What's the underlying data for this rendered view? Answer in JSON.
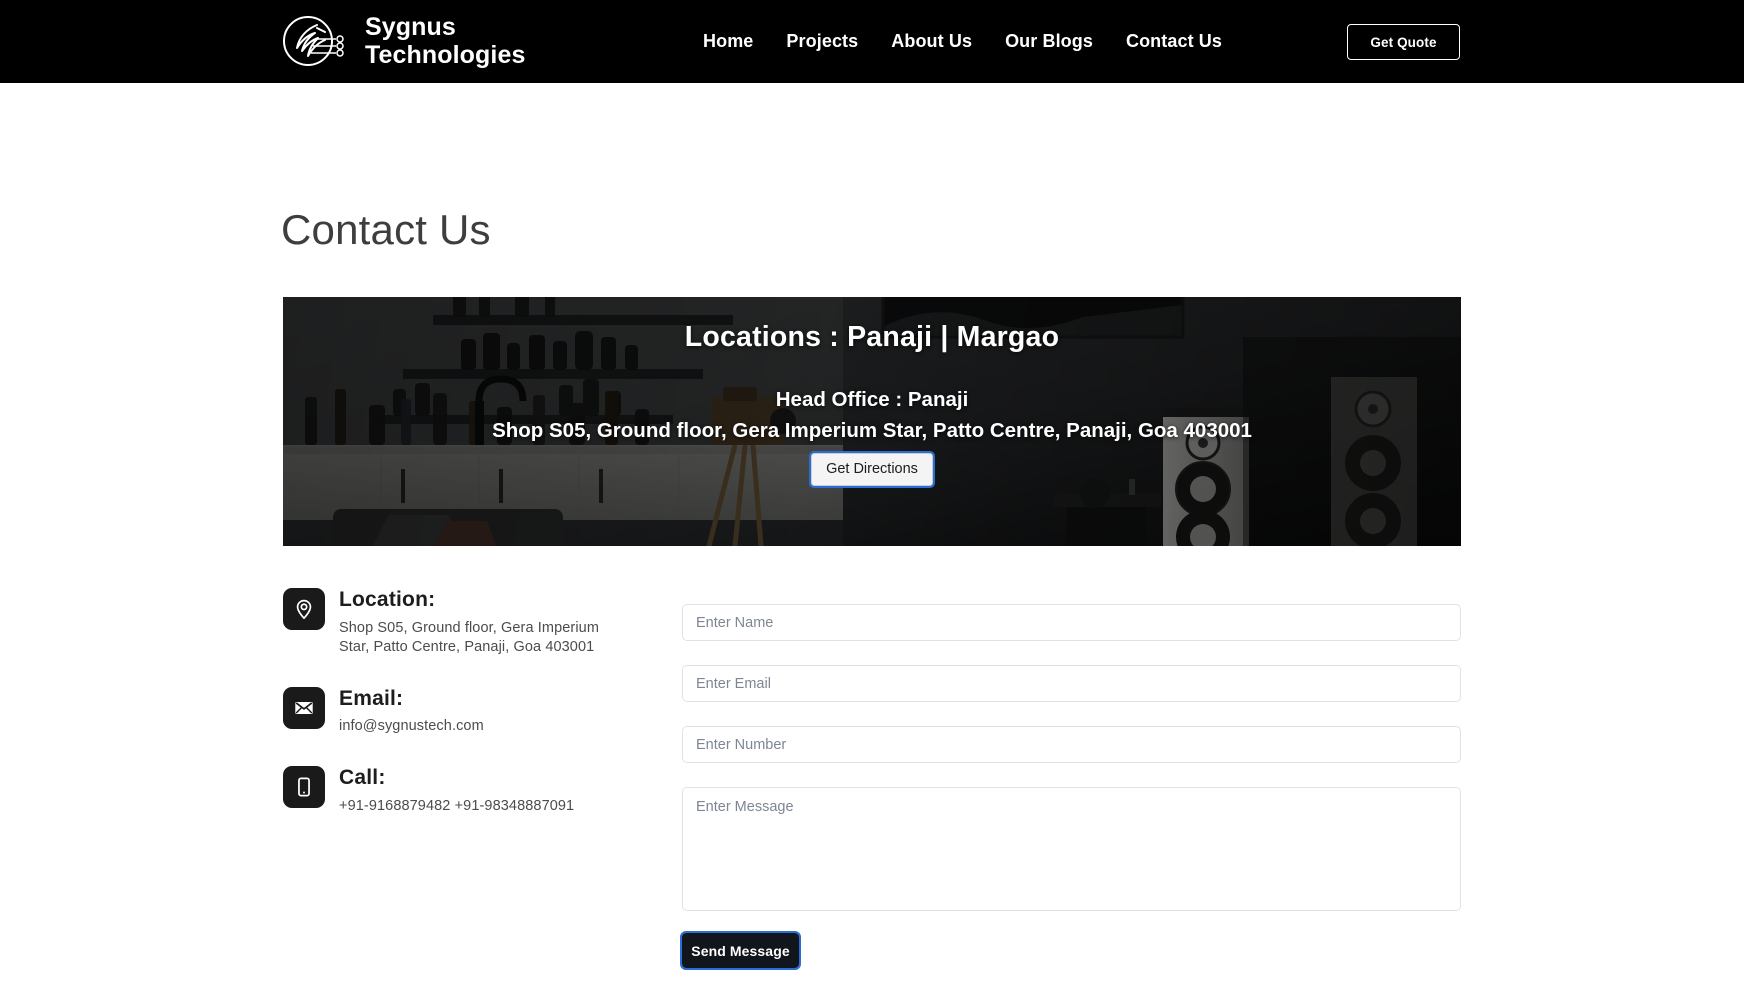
{
  "header": {
    "brand": {
      "name": "Sygnus\nTechnologies",
      "logo_icon": "sygnus-bird-circuit-logo"
    },
    "nav": [
      {
        "label": "Home"
      },
      {
        "label": "Projects"
      },
      {
        "label": "About Us"
      },
      {
        "label": "Our Blogs"
      },
      {
        "label": "Contact Us"
      }
    ],
    "quote_button": "Get Quote"
  },
  "page": {
    "title": "Contact Us"
  },
  "hero": {
    "locations": "Locations : Panaji | Margao",
    "head_office": "Head Office : Panaji",
    "address": "Shop S05, Ground floor, Gera Imperium Star, Patto Centre, Panaji, Goa 403001",
    "directions_button": "Get Directions"
  },
  "contact_info": [
    {
      "icon": "map-pin-icon",
      "label": "Location:",
      "text": "Shop S05, Ground floor, Gera Imperium Star, Patto Centre, Panaji, Goa 403001"
    },
    {
      "icon": "envelope-icon",
      "label": "Email:",
      "text": "info@sygnustech.com"
    },
    {
      "icon": "mobile-phone-icon",
      "label": "Call:",
      "text": "+91-9168879482 +91-98348887091"
    }
  ],
  "form": {
    "name_placeholder": "Enter Name",
    "email_placeholder": "Enter Email",
    "number_placeholder": "Enter Number",
    "message_placeholder": "Enter Message",
    "name_value": "",
    "email_value": "",
    "number_value": "",
    "message_value": "",
    "submit_label": "Send Message"
  },
  "colors": {
    "header_bg": "#000000",
    "page_bg": "#ffffff",
    "title_text": "#3e3e3e",
    "icon_tile": "#1a1a1a",
    "submit_bg": "#11151c",
    "focus_ring": "#2a6dd6",
    "field_border": "#dfe3e8"
  }
}
